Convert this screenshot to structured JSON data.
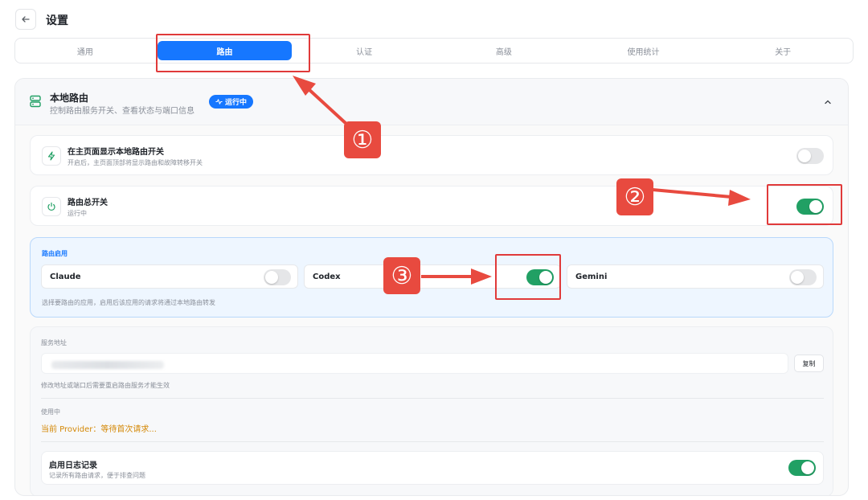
{
  "header": {
    "title": "设置"
  },
  "tabs": [
    {
      "label": "通用",
      "active": false
    },
    {
      "label": "路由",
      "active": true
    },
    {
      "label": "认证",
      "active": false
    },
    {
      "label": "高级",
      "active": false
    },
    {
      "label": "使用统计",
      "active": false
    },
    {
      "label": "关于",
      "active": false
    }
  ],
  "local_route": {
    "title": "本地路由",
    "subtitle": "控制路由服务开关、查看状态与端口信息",
    "status": "运行中",
    "show_on_home": {
      "title": "在主页面显示本地路由开关",
      "subtitle": "开启后，主页面顶部将显示路由和故障转移开关",
      "enabled": false
    },
    "master_switch": {
      "title": "路由总开关",
      "subtitle": "运行中",
      "enabled": true
    },
    "route_enable": {
      "label": "路由启用",
      "apps": [
        {
          "name": "Claude",
          "enabled": false
        },
        {
          "name": "Codex",
          "enabled": true
        },
        {
          "name": "Gemini",
          "enabled": false
        }
      ],
      "hint": "选择要路由的应用，启用后该应用的请求将通过本地路由转发"
    },
    "service": {
      "address_label": "服务地址",
      "copy_label": "复制",
      "address_hint": "修改地址或端口后需要重启路由服务才能生效",
      "in_use_label": "使用中",
      "provider_text": "当前 Provider：等待首次请求..."
    },
    "logging": {
      "title": "启用日志记录",
      "subtitle": "记录所有路由请求，便于排查问题",
      "enabled": true
    }
  },
  "annotations": [
    "①",
    "②",
    "③"
  ],
  "colors": {
    "accent": "#1677ff",
    "toggle_on": "#21a064",
    "annotation": "#e84a3f",
    "provider": "#d48806"
  }
}
